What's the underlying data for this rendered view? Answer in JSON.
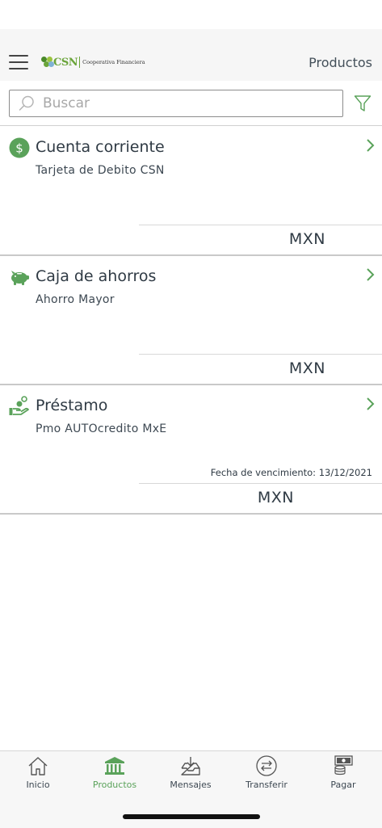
{
  "header": {
    "logo_text": "CSN",
    "logo_subtitle": "Cooperativa Financiera",
    "title": "Productos",
    "menu_icon": "hamburger-menu-icon"
  },
  "search": {
    "placeholder": "Buscar",
    "value": "",
    "icon": "search-icon",
    "filter_icon": "filter-icon"
  },
  "products": [
    {
      "icon": "dollar-circle-icon",
      "title": "Cuenta corriente",
      "subtitle": "Tarjeta de Debito CSN",
      "note": "",
      "currency": "MXN"
    },
    {
      "icon": "piggy-bank-icon",
      "title": "Caja de ahorros",
      "subtitle": "Ahorro Mayor",
      "note": "",
      "currency": "MXN"
    },
    {
      "icon": "hand-coins-icon",
      "title": "Préstamo",
      "subtitle": "Pmo AUTOcredito MxE",
      "note": "Fecha de vencimiento: 13/12/2021",
      "currency": "MXN"
    }
  ],
  "tabs": [
    {
      "label": "Inicio",
      "icon": "home-icon",
      "active": false
    },
    {
      "label": "Productos",
      "icon": "bank-icon",
      "active": true
    },
    {
      "label": "Mensajes",
      "icon": "inbox-icon",
      "active": false
    },
    {
      "label": "Transferir",
      "icon": "transfer-icon",
      "active": false
    },
    {
      "label": "Pagar",
      "icon": "pay-icon",
      "active": false
    }
  ],
  "colors": {
    "accent": "#5aa25a",
    "brand_green": "#6aa43a",
    "text": "#2f3a44",
    "divider": "#c9c9c9"
  }
}
